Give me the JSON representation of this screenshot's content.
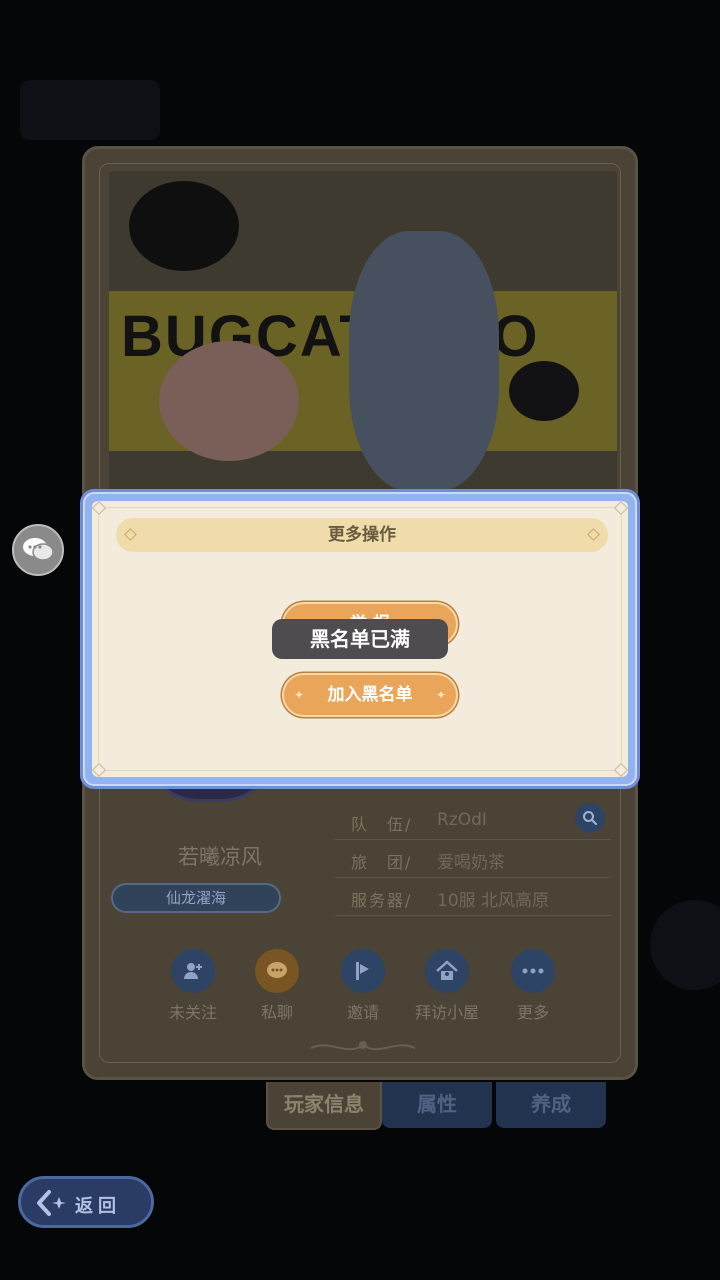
{
  "banner": {
    "title": "BUGCAT  MOO"
  },
  "profile": {
    "name": "若曦凉风",
    "title_badge": "仙龙濯海",
    "info": [
      {
        "key": "队　伍/",
        "value": "RzOdI"
      },
      {
        "key": "旅　团/",
        "value": "爱喝奶茶"
      },
      {
        "key": "服务器/",
        "value": "10服  北风高原"
      }
    ]
  },
  "actions": [
    {
      "icon": "add-user-icon",
      "label": "未关注",
      "color": "#2e4464"
    },
    {
      "icon": "chat-bubble-icon",
      "label": "私聊",
      "color": "#7a5524"
    },
    {
      "icon": "invite-flag-icon",
      "label": "邀请",
      "color": "#2e4464"
    },
    {
      "icon": "house-icon",
      "label": "拜访小屋",
      "color": "#2e4464"
    },
    {
      "icon": "more-dots-icon",
      "label": "更多",
      "color": "#2e4464"
    }
  ],
  "tabs": [
    {
      "label": "玩家信息",
      "active": true
    },
    {
      "label": "属性",
      "active": false
    },
    {
      "label": "养成",
      "active": false
    }
  ],
  "back_button": {
    "label": "返回"
  },
  "dialog": {
    "title": "更多操作",
    "report_button": "举 报",
    "blacklist_button": "加入黑名单"
  },
  "toast": {
    "text": "黑名单已满"
  }
}
